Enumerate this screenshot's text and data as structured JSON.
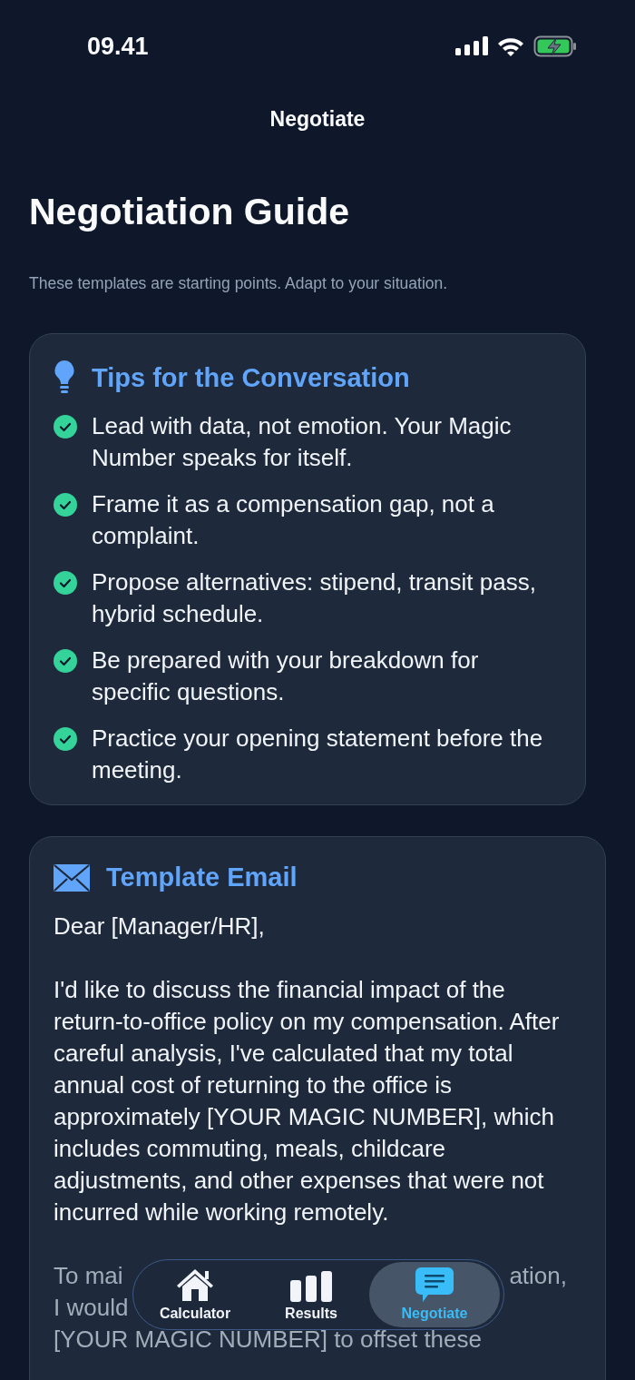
{
  "status_bar": {
    "time": "09.41"
  },
  "nav": {
    "title": "Negotiate"
  },
  "heading": "Negotiation Guide",
  "subtitle": "These templates are starting points. Adapt to your situation.",
  "tips": {
    "title": "Tips for the Conversation",
    "items": [
      {
        "text": "Lead with data, not emotion. Your Magic Number speaks for itself.",
        "done": true
      },
      {
        "text": "Frame it as a compensation gap, not a complaint.",
        "done": true
      },
      {
        "text": "Propose alternatives: stipend, transit pass, hybrid schedule.",
        "done": true
      },
      {
        "text": "Be prepared with your breakdown for specific questions.",
        "done": true
      },
      {
        "text": "Practice your opening statement before the meeting.",
        "done": true
      }
    ]
  },
  "email": {
    "title": "Template Email",
    "paragraphs": [
      {
        "text": "Dear [Manager/HR],",
        "dimmed": false
      },
      {
        "text": "I'd like to discuss the financial impact of the return-to-office policy on my compensation. After careful analysis, I've calculated that my total annual cost of returning to the office is approximately [YOUR MAGIC NUMBER], which includes commuting, meals, childcare adjustments, and other expenses that were not incurred while working remotely.",
        "dimmed": false
      },
      {
        "lines": [
          {
            "left": "To mai",
            "right": "ation,"
          },
          {
            "left": "I would"
          },
          {
            "left": "[YOUR MAGIC NUMBER] to offset these"
          }
        ],
        "dimmed": true
      }
    ]
  },
  "tab_bar": [
    {
      "label": "Calculator",
      "kind": "home",
      "selected": false
    },
    {
      "label": "Results",
      "kind": "stats",
      "selected": false
    },
    {
      "label": "Negotiate",
      "kind": "talk",
      "selected": true
    }
  ]
}
